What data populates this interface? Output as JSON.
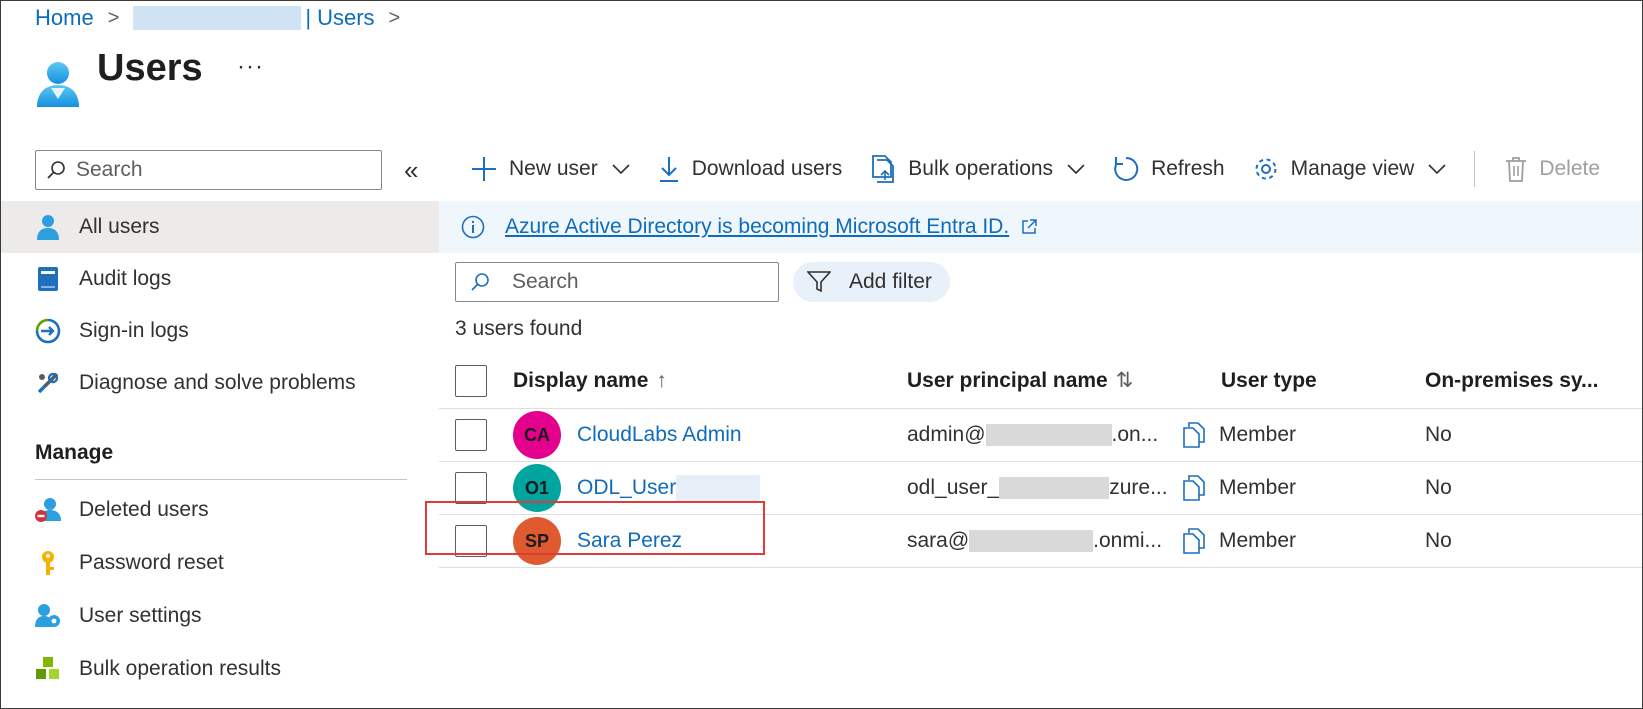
{
  "breadcrumb": {
    "home": "Home",
    "separator": ">",
    "pipe": "|",
    "current": "Users",
    "trailing_separator": ">"
  },
  "page": {
    "title": "Users",
    "more": "···"
  },
  "sidebar": {
    "search_placeholder": "Search",
    "collapse": "«",
    "items": [
      {
        "label": "All users",
        "icon": "user-icon",
        "active": true
      },
      {
        "label": "Audit logs",
        "icon": "audit-log-icon"
      },
      {
        "label": "Sign-in logs",
        "icon": "sign-in-icon"
      },
      {
        "label": "Diagnose and solve problems",
        "icon": "wrench-icon"
      }
    ],
    "manage_label": "Manage",
    "manage_items": [
      {
        "label": "Deleted users",
        "icon": "deleted-user-icon"
      },
      {
        "label": "Password reset",
        "icon": "key-icon"
      },
      {
        "label": "User settings",
        "icon": "user-settings-icon"
      },
      {
        "label": "Bulk operation results",
        "icon": "cubes-icon"
      }
    ]
  },
  "toolbar": {
    "new_user": "New user",
    "download_users": "Download users",
    "bulk_operations": "Bulk operations",
    "refresh": "Refresh",
    "manage_view": "Manage view",
    "delete": "Delete"
  },
  "banner": {
    "text": "Azure Active Directory is becoming Microsoft Entra ID."
  },
  "filters": {
    "search_placeholder": "Search",
    "add_filter": "Add filter"
  },
  "results": {
    "count_text": "3 users found"
  },
  "table": {
    "columns": {
      "display_name": "Display name",
      "display_name_sort": "↑",
      "upn": "User principal name",
      "upn_sort": "⇅",
      "user_type": "User type",
      "on_premises": "On-premises sy..."
    },
    "rows": [
      {
        "initials": "CA",
        "avatar_color": "#e3008c",
        "name": "CloudLabs Admin",
        "upn_start": "admin@",
        "upn_end": ".on...",
        "type": "Member",
        "on_premises": "No"
      },
      {
        "initials": "O1",
        "avatar_color": "#00a5a0",
        "name": "ODL_User",
        "upn_start": "odl_user_",
        "upn_end": "zure...",
        "type": "Member",
        "on_premises": "No"
      },
      {
        "initials": "SP",
        "avatar_color": "#e05a30",
        "name": "Sara Perez",
        "upn_start": "sara@",
        "upn_end": ".onmi...",
        "type": "Member",
        "on_premises": "No"
      }
    ]
  },
  "colors": {
    "link": "#0f6cbd",
    "highlight": "#e03a3a",
    "banner_bg": "#eff6fc"
  }
}
